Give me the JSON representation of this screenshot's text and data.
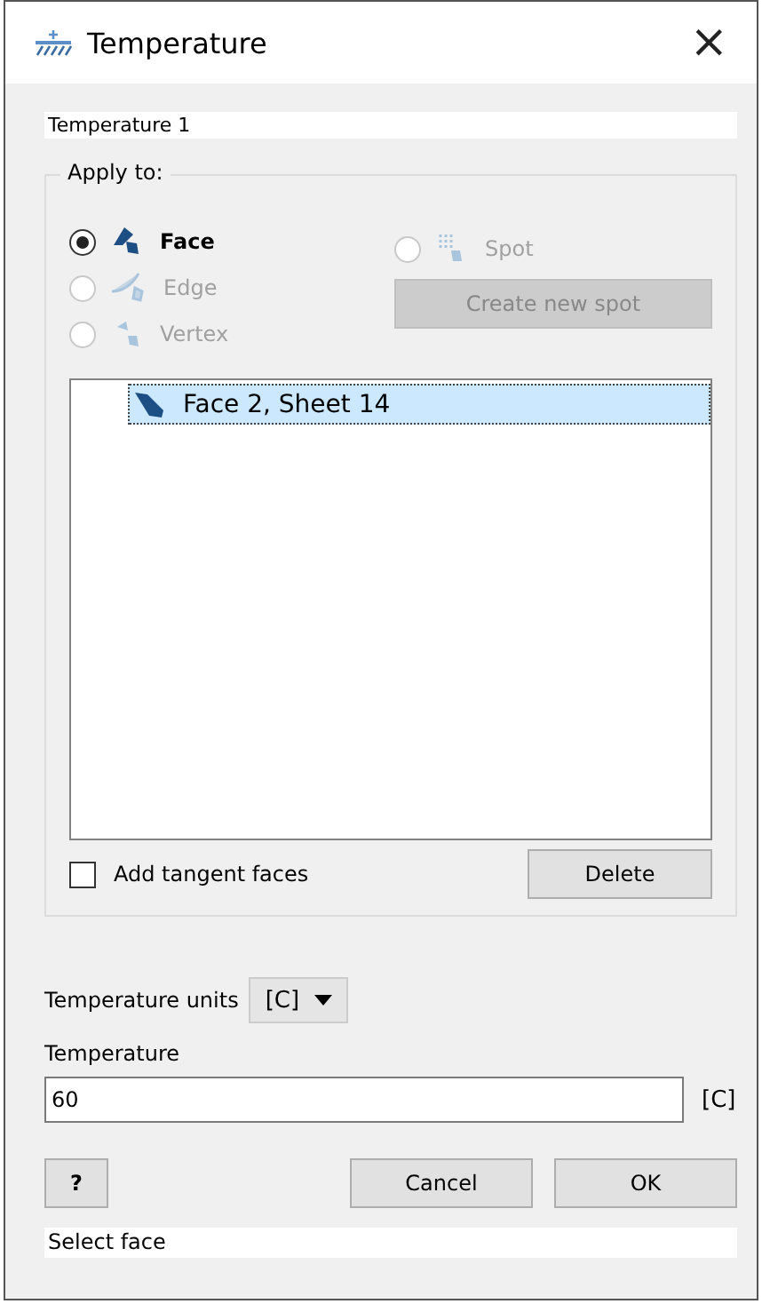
{
  "window": {
    "title": "Temperature",
    "close": "×"
  },
  "name_field": {
    "value": "Temperature 1"
  },
  "apply_to": {
    "title": "Apply to:",
    "options": [
      {
        "kind": "face",
        "label": "Face",
        "selected": true,
        "disabled": false
      },
      {
        "kind": "edge",
        "label": "Edge",
        "selected": false,
        "disabled": true
      },
      {
        "kind": "vertex",
        "label": "Vertex",
        "selected": false,
        "disabled": true
      },
      {
        "kind": "spot",
        "label": "Spot",
        "selected": false,
        "disabled": true
      }
    ],
    "create_button": {
      "label": "Create new spot",
      "disabled": true
    },
    "selection_list": [
      {
        "label": "Face 2, Sheet 14",
        "selected": true
      }
    ],
    "tangent_checkbox": {
      "label": "Add tangent faces",
      "checked": false
    },
    "delete_button": {
      "label": "Delete",
      "disabled": false
    }
  },
  "units": {
    "label": "Temperature units",
    "value": "[C]"
  },
  "temperature": {
    "label": "Temperature",
    "value": "60",
    "unit": "[C]"
  },
  "buttons": {
    "help": "?",
    "cancel": "Cancel",
    "ok": "OK"
  },
  "status_bar": "Select face"
}
